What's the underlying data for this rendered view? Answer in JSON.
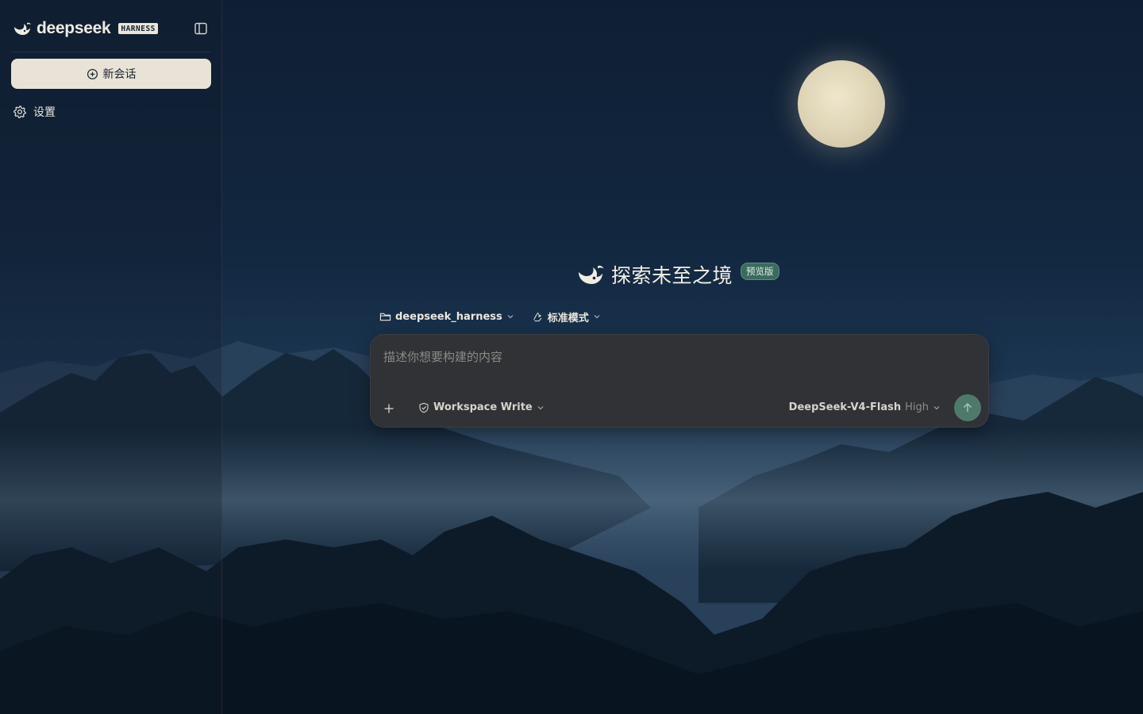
{
  "brand": {
    "name": "deepseek",
    "badge": "HARNESS",
    "logo_icon": "deepseek-whale-icon"
  },
  "sidebar": {
    "collapse_icon": "sidebar-toggle-icon",
    "new_chat_label": "新会话",
    "new_chat_icon": "plus-circle-icon",
    "settings_label": "设置",
    "settings_icon": "gear-icon"
  },
  "hero": {
    "title": "探索未至之境",
    "badge": "预览版",
    "logo_icon": "deepseek-whale-icon"
  },
  "context": {
    "workspace": "deepseek_harness",
    "workspace_icon": "folder-icon",
    "mode": "标准模式",
    "mode_icon": "recycle-icon"
  },
  "composer": {
    "placeholder": "描述你想要构建的内容",
    "value": "",
    "attach_icon": "plus-icon",
    "permission": "Workspace Write",
    "permission_icon": "shield-check-icon",
    "model": "DeepSeek-V4-Flash",
    "effort": "High",
    "send_icon": "arrow-up-icon"
  },
  "colors": {
    "accent": "#4e7a6c",
    "badge_bg": "#3b6a5e",
    "composer_bg": "#303236",
    "button_light": "#e8e3d6"
  }
}
